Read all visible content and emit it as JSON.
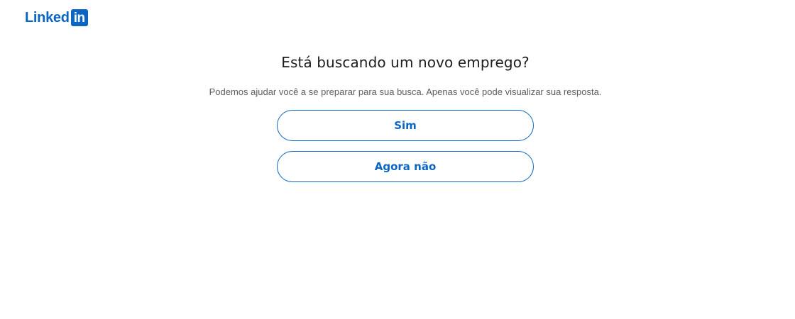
{
  "brand": {
    "word": "Linked",
    "box": "in",
    "color": "#0a66c2"
  },
  "prompt": {
    "title": "Está buscando um novo emprego?",
    "subtitle": "Podemos ajudar você a se preparar para sua busca. Apenas você pode visualizar sua resposta."
  },
  "actions": {
    "yes_label": "Sim",
    "no_label": "Agora não"
  }
}
